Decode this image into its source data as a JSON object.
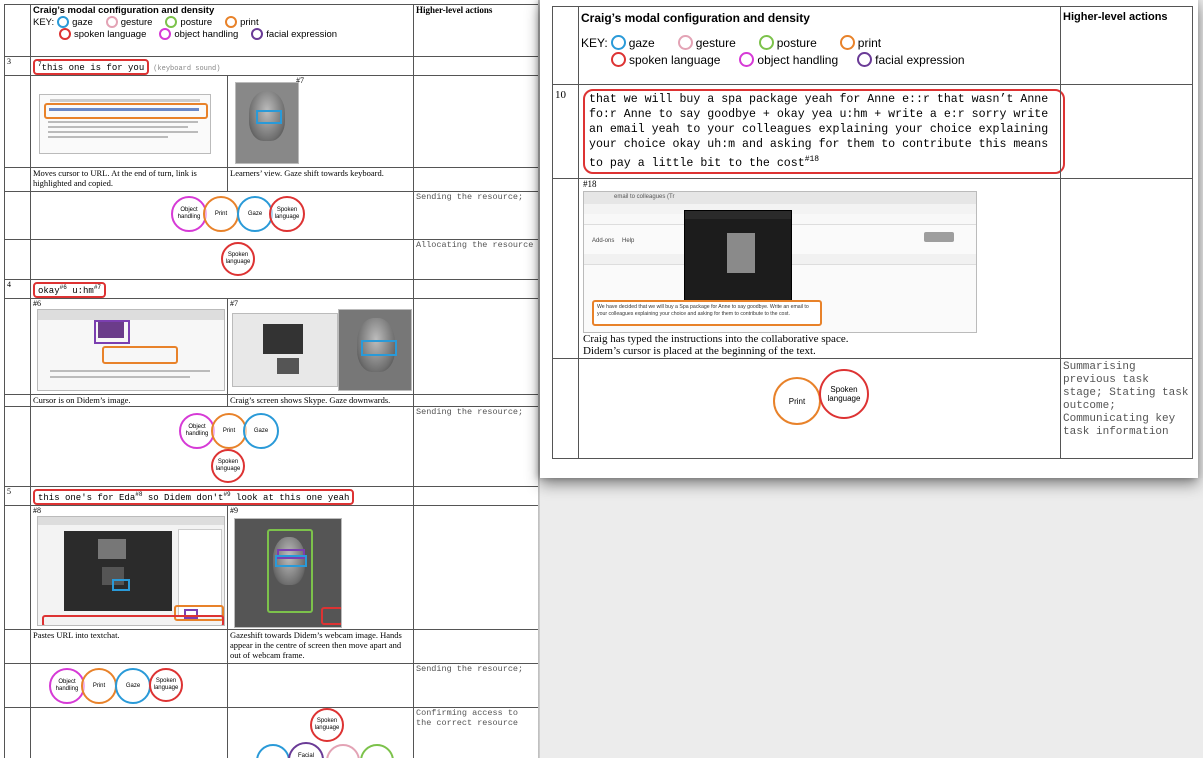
{
  "left": {
    "title": "Craig’s modal configuration and density",
    "higher_level_header": "Higher-level actions",
    "key_label": "KEY:",
    "key": [
      {
        "label": "gaze",
        "color": "#2a9ad8"
      },
      {
        "label": "gesture",
        "color": "#e3a3b5"
      },
      {
        "label": "posture",
        "color": "#7cc24b"
      },
      {
        "label": "print",
        "color": "#e8822a"
      },
      {
        "label": "spoken language",
        "color": "#d33333"
      },
      {
        "label": "object handling",
        "color": "#d63ad6"
      },
      {
        "label": "facial expression",
        "color": "#6a3a96"
      }
    ],
    "turn3": {
      "num": "3",
      "utterance_sup": "7",
      "utterance": "this one is for you",
      "note": "(keyboard sound)",
      "frame_ref": "#7",
      "caption_left": "Moves cursor to URL. At the end of turn, link is highlighted and copied.",
      "caption_right": "Learners’ view. Gaze shift towards keyboard.",
      "action1": "Sending the resource;",
      "action2": "Allocating the resource",
      "bubbles1": [
        "Object handling",
        "Print",
        "Gaze",
        "Spoken language"
      ],
      "bubbles2": [
        "Spoken language"
      ]
    },
    "turn4": {
      "num": "4",
      "utterance": "okay",
      "sup1": "#6",
      "utterance2": " u:hm",
      "sup2": "#7",
      "frame1": "#6",
      "frame2": "#7",
      "caption_left": "Cursor is on Didem’s image.",
      "caption_right": "Craig’s screen shows Skype. Gaze downwards.",
      "action": "Sending the resource;",
      "bubbles": [
        "Object handling",
        "Print",
        "Gaze",
        "Spoken language"
      ]
    },
    "turn5": {
      "num": "5",
      "utterance": "this one's for Eda",
      "sup1": "#8",
      "utterance2": " so Didem don't",
      "sup2": "#9",
      "utterance3": " look at this one yeah",
      "frame1": "#8",
      "frame2": "#9",
      "caption_left": "Pastes URL into textchat.",
      "caption_right": "Gazeshift towards Didem’s webcam image. Hands appear in the centre of screen then move apart and out of webcam frame.",
      "action1": "Sending the resource;",
      "action2": "Confirming access to the correct resource",
      "bubbles1": [
        "Object handling",
        "Print",
        "Gaze",
        "Spoken language"
      ],
      "bubbles2": [
        "Spoken language",
        "Gaze",
        "Facial expression",
        "Gesture",
        "Posture"
      ]
    }
  },
  "right": {
    "title": "Craig’s modal configuration and density",
    "higher_level_header": "Higher-level actions",
    "key_label": "KEY:",
    "turn10": {
      "num": "10",
      "utterance": "that we will buy a spa package yeah for Anne e::r that wasn’t Anne fo:r Anne to say goodbye + okay yea u:hm + write a e:r sorry write an email yeah to your colleagues explaining your choice explaining your choice okay uh:m and asking for them to contribute this means to pay a little bit to the cost",
      "sup": "#18",
      "frame": "#18",
      "doc_text": "We have decided that we will buy a Spa package for Anne to say goodbye. Write an email to your colleagues explaining your choice and asking for them to contribute to the cost.",
      "browser_tab": "email to colleagues (Tr",
      "browser_menu": [
        "Add-ons",
        "Help"
      ],
      "caption": "Craig has typed the instructions into the collaborative space.",
      "caption2": "Didem’s cursor is placed at the beginning of the text.",
      "actions": "Summarising previous task stage; Stating task outcome; Communicating key task information",
      "bubbles": [
        "Print",
        "Spoken language"
      ]
    }
  }
}
